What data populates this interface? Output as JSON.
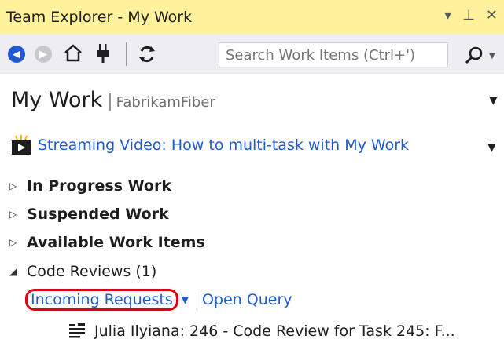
{
  "window": {
    "title": "Team Explorer - My Work",
    "controls": [
      "▾",
      "⊥",
      "✕"
    ]
  },
  "toolbar": {
    "search_placeholder": "Search Work Items (Ctrl+')"
  },
  "header": {
    "title": "My Work",
    "separator": "|",
    "project": "FabrikamFiber"
  },
  "video": {
    "link": "Streaming Video: How to multi-task with My Work"
  },
  "sections": [
    {
      "label": "In Progress Work",
      "expanded": false
    },
    {
      "label": "Suspended Work",
      "expanded": false
    },
    {
      "label": "Available Work Items",
      "expanded": false
    },
    {
      "label": "Code Reviews (1)",
      "expanded": true
    }
  ],
  "code_reviews": {
    "incoming_label": "Incoming Requests",
    "open_query_label": "Open Query",
    "items": [
      {
        "text": "Julia Ilyiana: 246 - Code Review for Task 245: F..."
      }
    ]
  },
  "colors": {
    "titlebar_bg": "#fff29d",
    "toolbar_bg": "#eeeef2",
    "link": "#1e5bd1",
    "highlight_ring": "#e3000f"
  }
}
